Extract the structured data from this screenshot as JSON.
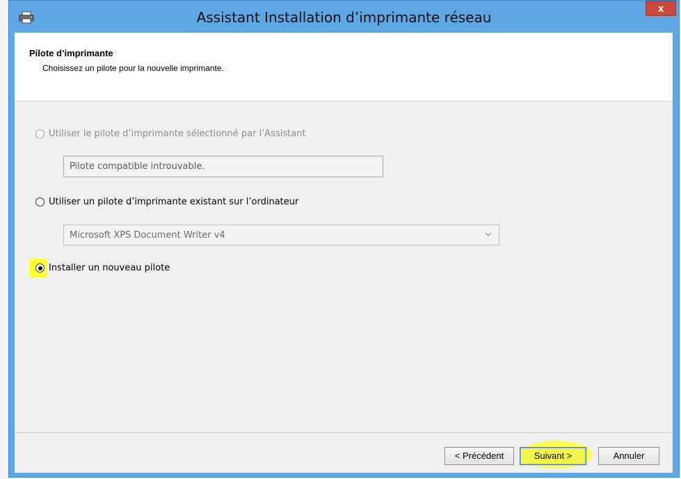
{
  "window": {
    "title": "Assistant Installation d’imprimante réseau",
    "close_label": "x"
  },
  "header": {
    "title": "Pilote d’imprimante",
    "subtitle": "Choisissez un pilote pour la nouvelle imprimante."
  },
  "options": {
    "wizard_driver": {
      "label": "Utiliser le pilote d’imprimante sélectionné par l’Assistant",
      "selected": false,
      "enabled": false,
      "field_value": "Pilote compatible introuvable."
    },
    "existing_driver": {
      "label": "Utiliser un pilote d’imprimante existant sur l’ordinateur",
      "selected": false,
      "enabled": true,
      "selected_driver": "Microsoft XPS Document Writer v4"
    },
    "new_driver": {
      "label": "Installer un nouveau pilote",
      "selected": true,
      "enabled": true
    }
  },
  "buttons": {
    "back": "< Précédent",
    "next": "Suivant >",
    "cancel": "Annuler"
  },
  "colors": {
    "titlebar": "#5fa6e4",
    "close": "#c94a3c",
    "highlight": "#ffff38"
  },
  "icons": {
    "title": "printer-icon",
    "dropdown": "chevron-down-icon"
  }
}
